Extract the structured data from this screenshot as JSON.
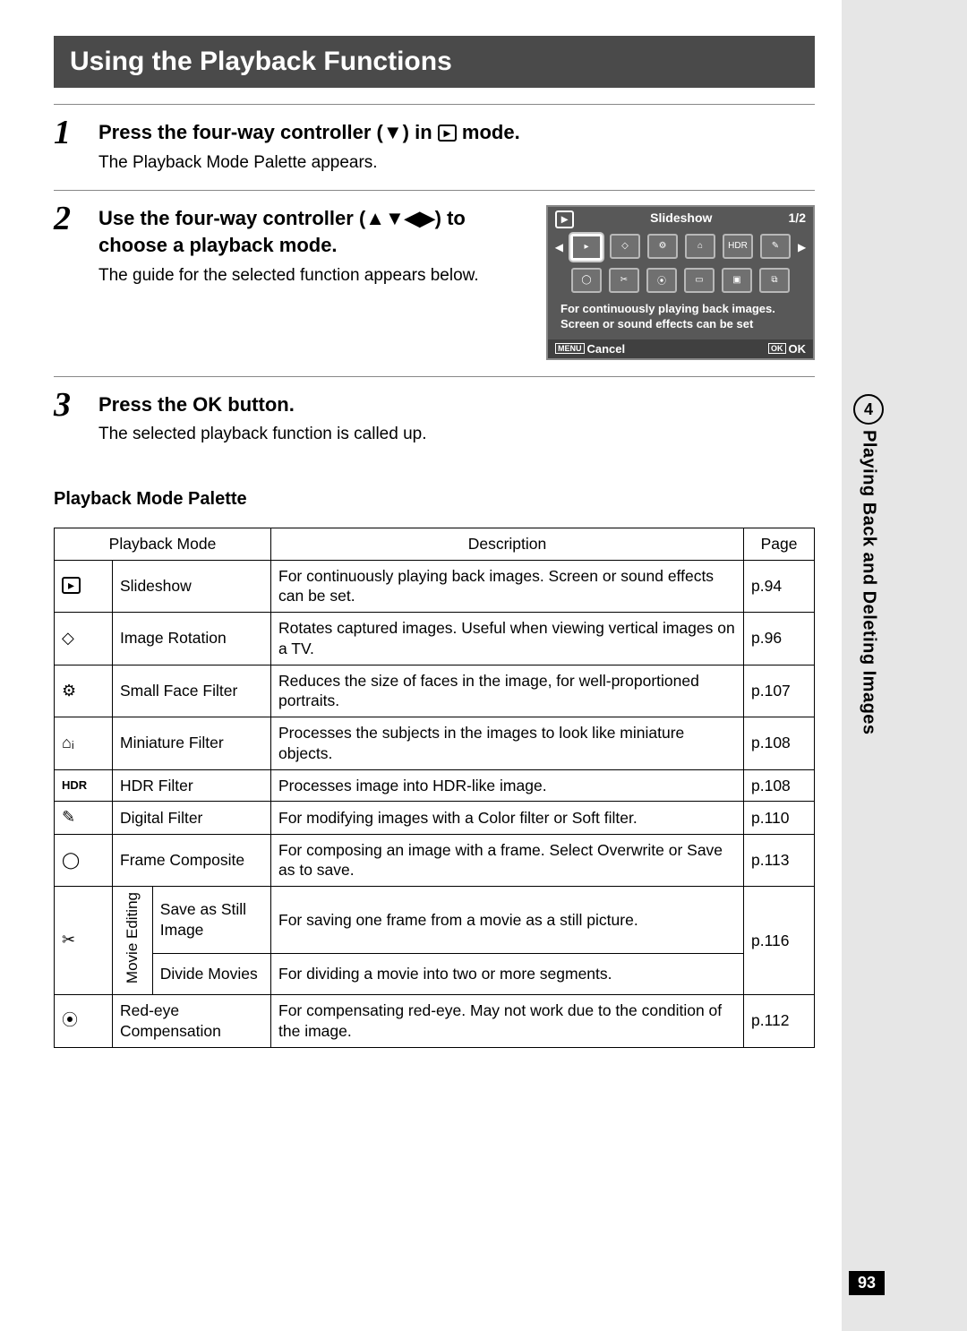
{
  "chapter": {
    "number": "4",
    "title": "Playing Back and Deleting Images"
  },
  "page_number": "93",
  "section_title": "Using the Playback Functions",
  "steps": [
    {
      "n": "1",
      "headline_pre": "Press the four-way controller (",
      "headline_mid": ") in ",
      "headline_post": " mode.",
      "arrow": "▼",
      "mode_icon": "▸",
      "body": "The Playback Mode Palette appears."
    },
    {
      "n": "2",
      "headline_pre": "Use the four-way controller (",
      "headline_post": ") to choose a playback mode.",
      "arrows": "▲▼◀▶",
      "body": "The guide for the selected function appears below."
    },
    {
      "n": "3",
      "headline_pre": "Press the ",
      "headline_btn": "OK",
      "headline_post": " button.",
      "body": "The selected playback function is called up."
    }
  ],
  "lcd": {
    "mode_indicator": "▸",
    "title": "Slideshow",
    "page": "1/2",
    "row1": [
      "▸",
      "◇",
      "⚙",
      "⌂",
      "HDR",
      "✎"
    ],
    "row2": [
      "◯",
      "✂",
      "⦿",
      "▭",
      "▣",
      "⧉"
    ],
    "help": "For continuously playing back images. Screen or sound effects can be set",
    "footer_left_btn": "MENU",
    "footer_left_label": "Cancel",
    "footer_right_btn": "OK",
    "footer_right_label": "OK"
  },
  "subsection": "Playback Mode Palette",
  "table": {
    "headers": {
      "mode": "Playback Mode",
      "desc": "Description",
      "page": "Page"
    },
    "rows": [
      {
        "icon": "▸",
        "mode": "Slideshow",
        "desc": "For continuously playing back images. Screen or sound effects can be set.",
        "page": "p.94"
      },
      {
        "icon": "◇",
        "mode": "Image Rotation",
        "desc": "Rotates captured images. Useful when viewing vertical images on a TV.",
        "page": "p.96"
      },
      {
        "icon": "⚙",
        "mode": "Small Face Filter",
        "desc": "Reduces the size of faces in the image, for well-proportioned portraits.",
        "page": "p.107"
      },
      {
        "icon": "⌂ᵢ",
        "mode": "Miniature Filter",
        "desc": "Processes the subjects in the images to look like miniature objects.",
        "page": "p.108"
      },
      {
        "icon": "HDR",
        "mode": "HDR Filter",
        "desc": "Processes image into HDR-like image.",
        "page": "p.108"
      },
      {
        "icon": "✎",
        "mode": "Digital Filter",
        "desc": "For modifying images with a Color filter or Soft filter.",
        "page": "p.110"
      },
      {
        "icon": "◯",
        "mode": "Frame Composite",
        "desc": "For composing an image with a frame. Select Overwrite or Save as to save.",
        "page": "p.113"
      }
    ],
    "movie_editing": {
      "icon": "✂",
      "group_label": "Movie Editing",
      "sub": [
        {
          "mode": "Save as Still Image",
          "desc": "For saving one frame from a movie as a still picture."
        },
        {
          "mode": "Divide Movies",
          "desc": "For dividing a movie into two or more segments."
        }
      ],
      "page": "p.116"
    },
    "last": {
      "icon": "⦿",
      "mode": "Red-eye Compensation",
      "desc": "For compensating red-eye. May not work due to the condition of the image.",
      "page": "p.112"
    }
  }
}
